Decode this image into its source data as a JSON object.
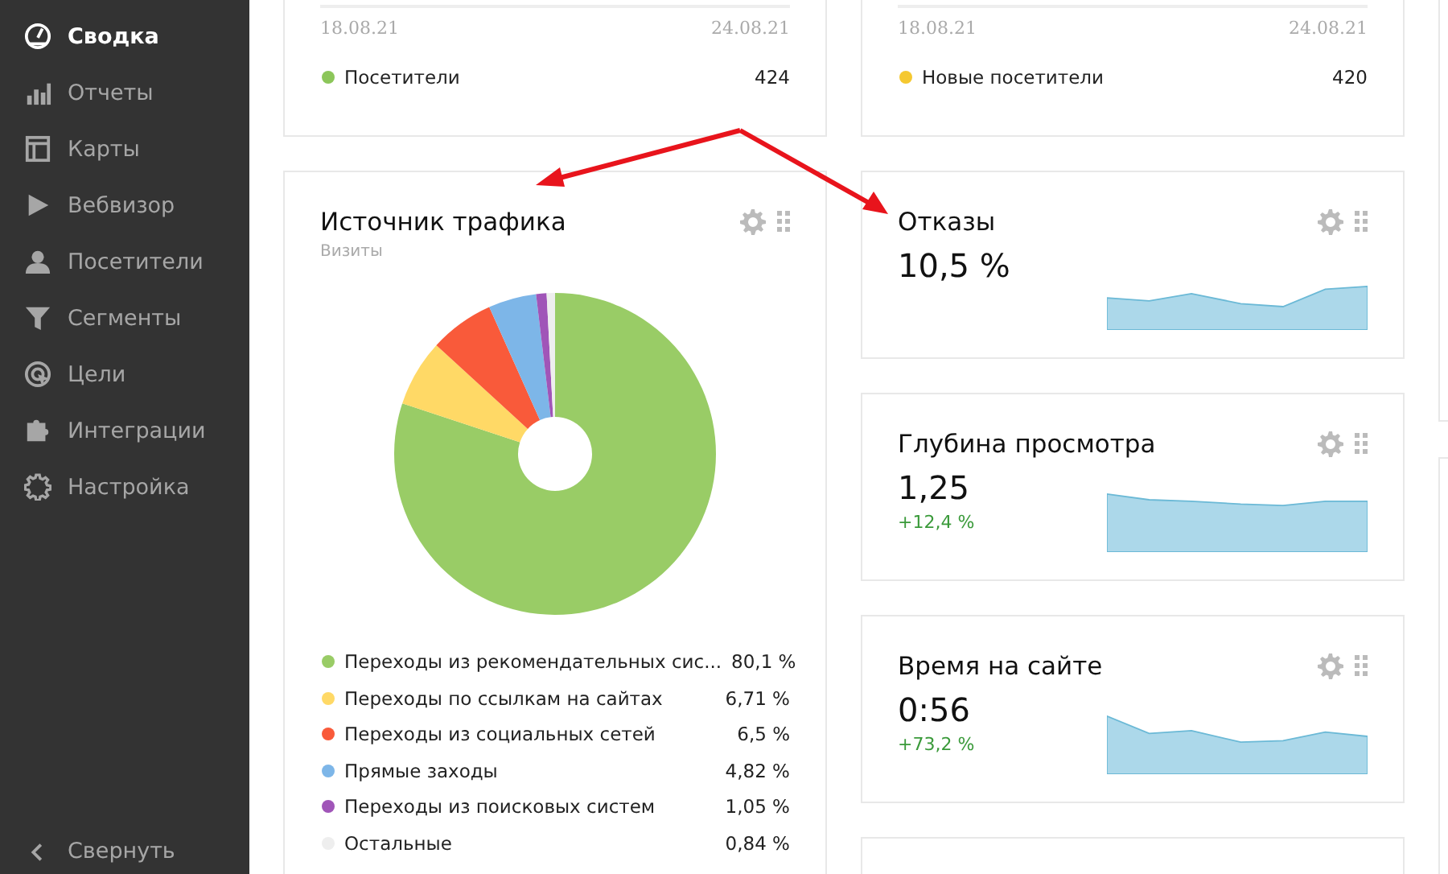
{
  "sidebar": {
    "items": [
      {
        "label": "Сводка",
        "selected": true
      },
      {
        "label": "Отчеты",
        "selected": false
      },
      {
        "label": "Карты",
        "selected": false
      },
      {
        "label": "Вебвизор",
        "selected": false
      },
      {
        "label": "Посетители",
        "selected": false
      },
      {
        "label": "Сегменты",
        "selected": false
      },
      {
        "label": "Цели",
        "selected": false
      },
      {
        "label": "Интеграции",
        "selected": false
      },
      {
        "label": "Настройка",
        "selected": false
      }
    ],
    "collapse": {
      "label": "Свернуть"
    }
  },
  "top_cards": [
    {
      "date_start": "18.08.21",
      "date_end": "24.08.21",
      "legend": {
        "label": "Посетители",
        "value": "424",
        "color": "#8cc65a"
      }
    },
    {
      "date_start": "18.08.21",
      "date_end": "24.08.21",
      "legend": {
        "label": "Новые посетители",
        "value": "420",
        "color": "#f5c830"
      }
    }
  ],
  "traffic_card": {
    "title": "Источник трафика",
    "subtitle": "Визиты",
    "chart_data": {
      "type": "donut",
      "categories": [
        "Переходы из рекомендательных сис...",
        "Переходы по ссылкам на сайтах",
        "Переходы из социальных сетей",
        "Прямые заходы",
        "Переходы из поисковых систем",
        "Остальные"
      ],
      "values": [
        80.1,
        6.71,
        6.5,
        4.82,
        1.05,
        0.84
      ]
    },
    "legend": [
      {
        "value": "80,1 %",
        "color": "#99cc66"
      },
      {
        "value": "6,71 %",
        "color": "#ffd966"
      },
      {
        "value": "6,5 %",
        "color": "#f95a3a"
      },
      {
        "value": "4,82 %",
        "color": "#7db6e8"
      },
      {
        "value": "1,05 %",
        "color": "#a055b8"
      },
      {
        "value": "0,84 %",
        "color": "#eeeeee"
      }
    ]
  },
  "metrics": [
    {
      "title": "Отказы",
      "value": "10,5 %"
    },
    {
      "title": "Глубина просмотра",
      "value": "1,25",
      "delta": "+12,4 %"
    },
    {
      "title": "Время на сайте",
      "value": "0:56",
      "delta": "+73,2 %"
    }
  ]
}
